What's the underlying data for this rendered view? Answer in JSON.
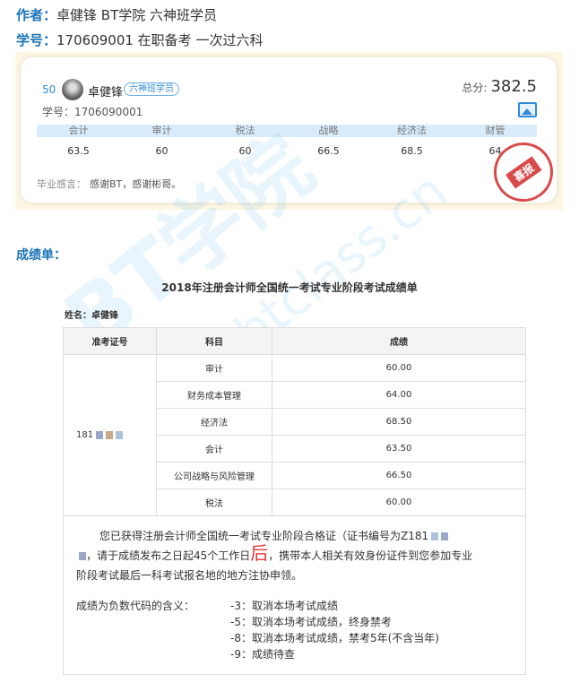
{
  "header": {
    "author_label": "作者：",
    "author_value": "卓健锋  BT学院 六神班学员",
    "id_label": "学号：",
    "id_value": "170609001   在职备考 一次过六科"
  },
  "card": {
    "rank": "50",
    "name": "卓健锋",
    "badge": "六神班学员",
    "student_id": "学号：1706090001",
    "total_label": "总分:",
    "total_value": "382.5",
    "subjects": [
      "会计",
      "审计",
      "税法",
      "战略",
      "经济法",
      "财管"
    ],
    "values": [
      "63.5",
      "60",
      "60",
      "66.5",
      "68.5",
      "64"
    ],
    "graduation_label": "毕业感言：",
    "graduation_text": "感谢BT，感谢彬哥。",
    "stamp_text": "喜报"
  },
  "section_title": "成绩单：",
  "document": {
    "title": "2018年注册会计师全国统一考试专业阶段考试成绩单",
    "name_line": "姓名：卓健锋",
    "table_headers": [
      "准考证号",
      "科目",
      "成绩"
    ],
    "exam_id": "181",
    "rows": [
      {
        "subject": "审计",
        "score": "60.00"
      },
      {
        "subject": "财务成本管理",
        "score": "64.00"
      },
      {
        "subject": "经济法",
        "score": "68.50"
      },
      {
        "subject": "会计",
        "score": "63.50"
      },
      {
        "subject": "公司战略与风险管理",
        "score": "66.50"
      },
      {
        "subject": "税法",
        "score": "60.00"
      }
    ],
    "notice_line1": "您已获得注册会计师全国统一考试专业阶段合格证（证书编号为Z181",
    "notice_line2_a": "，请于成绩发布之日起45个工作日",
    "notice_line2_big": "后",
    "notice_line2_b": "，携带本人相关有效身份证件到您参加专业",
    "notice_line3": "阶段考试最后一科考试报名地的地方注协申领。",
    "codes_label": "成绩为负数代码的含义：",
    "codes": [
      "-3：取消本场考试成绩",
      "-5：取消本场考试成绩，终身禁考",
      "-8：取消本场考试成绩，禁考5年(不含当年)",
      "-9：成绩待查"
    ]
  },
  "watermark": {
    "main": "BT学院",
    "sub": "btclass.cn"
  },
  "colors": {
    "accent": "#1a73b8",
    "stamp": "#d94a4a",
    "highlight": "#e53935"
  }
}
